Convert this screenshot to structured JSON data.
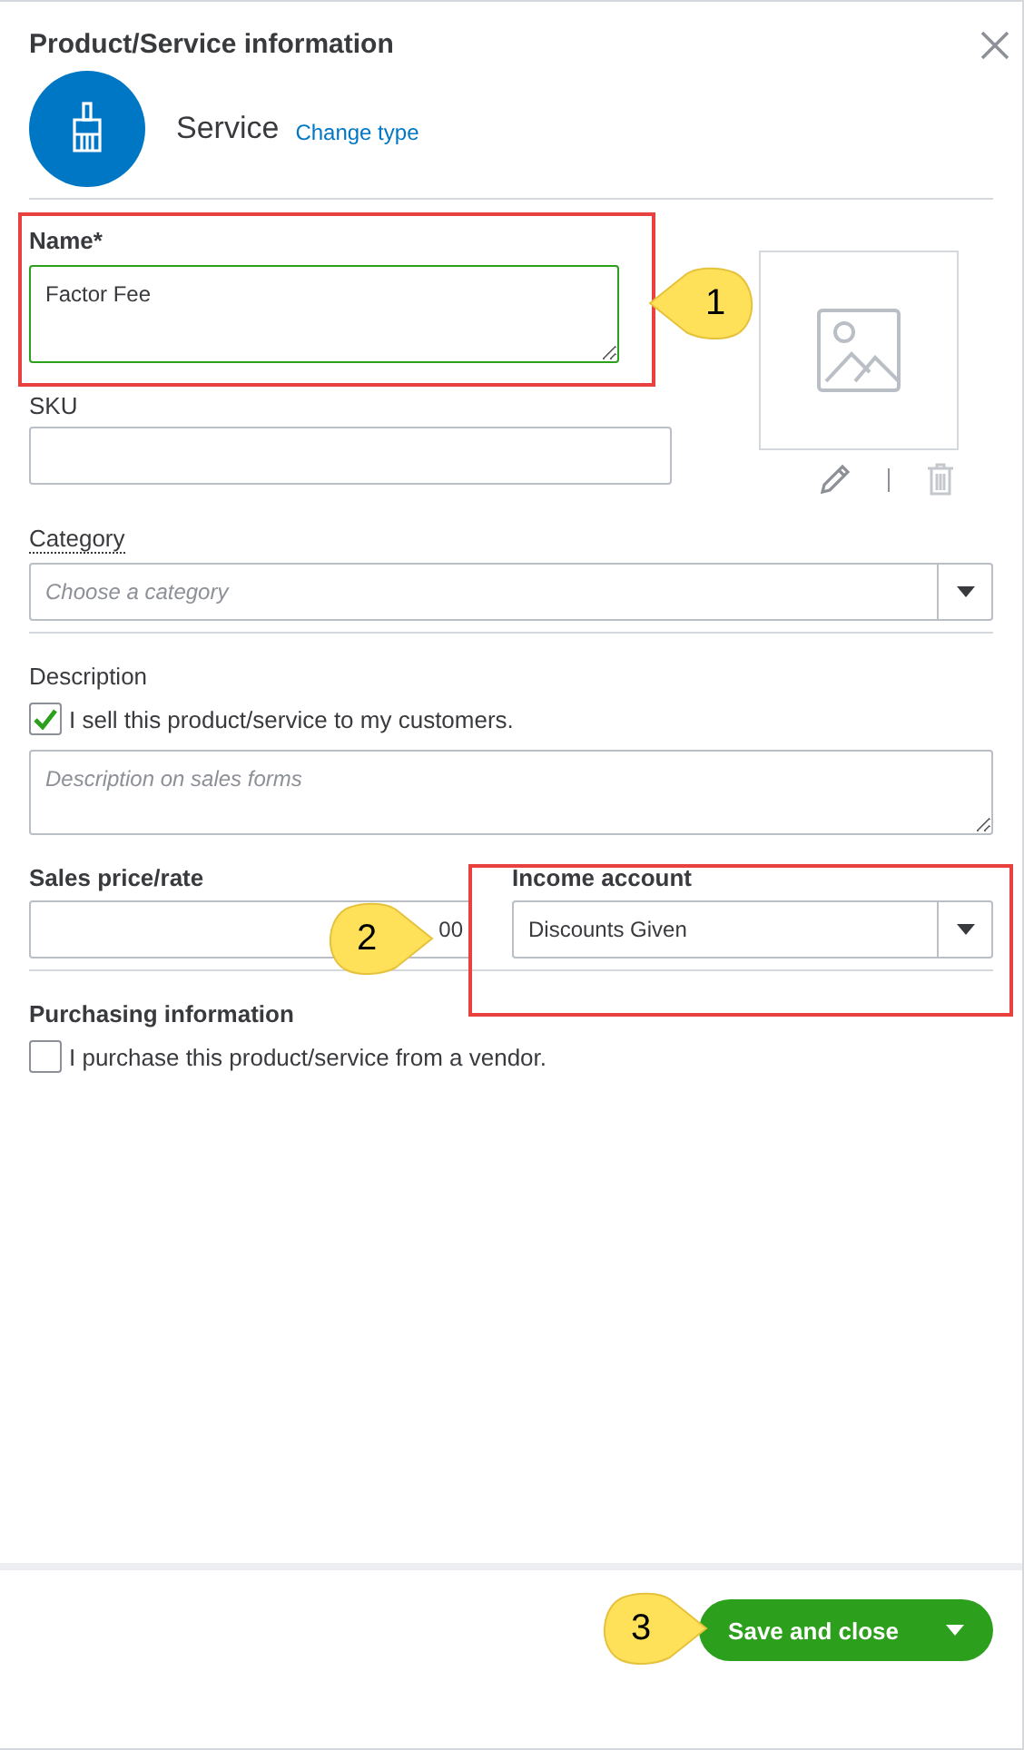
{
  "dialog": {
    "title": "Product/Service information"
  },
  "type": {
    "label": "Service",
    "link": "Change type"
  },
  "name": {
    "label": "Name*",
    "value": "Factor Fee",
    "valid": true
  },
  "sku": {
    "label": "SKU"
  },
  "category": {
    "label": "Category",
    "placeholder": "Choose a category"
  },
  "description": {
    "label": "Description",
    "checkbox": {
      "label": "I sell this product/service to my customers.",
      "checked": true
    },
    "placeholder": "Description on sales forms"
  },
  "sales_price": {
    "label": "Sales price/rate",
    "value": "00"
  },
  "income_account": {
    "label": "Income account",
    "value": "Discounts Given"
  },
  "purchasing": {
    "label": "Purchasing information",
    "checkbox": {
      "label": "I purchase this product/service from a vendor.",
      "checked": false
    }
  },
  "footer": {
    "button": "Save and close"
  },
  "callouts": [
    {
      "number": "1"
    },
    {
      "number": "2"
    },
    {
      "number": "3"
    }
  ]
}
